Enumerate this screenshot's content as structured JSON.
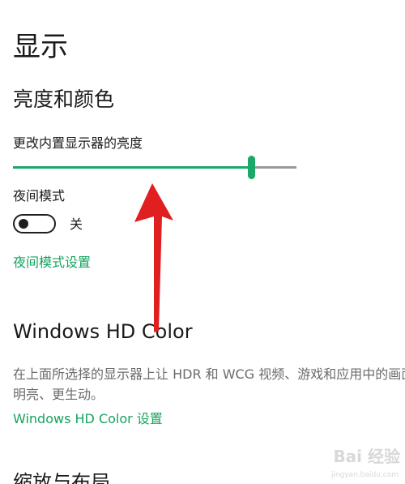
{
  "page": {
    "title": "显示"
  },
  "brightness_color": {
    "heading": "亮度和颜色",
    "slider_label": "更改内置显示器的亮度",
    "brightness_value": 0.84
  },
  "night_mode": {
    "label": "夜间模式",
    "toggle_state": "关",
    "is_on": false,
    "settings_link": "夜间模式设置"
  },
  "hd_color": {
    "heading": "Windows HD Color",
    "description_line1": "在上面所选择的显示器上让 HDR 和 WCG 视频、游戏和应用中的画面更",
    "description_line2": "明亮、更生动。",
    "settings_link": "Windows HD Color 设置"
  },
  "scale_layout": {
    "heading": "缩放与布局"
  },
  "watermark": {
    "brand": "Bai 经验",
    "url": "jingyan.baidu.com"
  },
  "colors": {
    "accent": "#1aa968",
    "link": "#17a35f",
    "arrow": "#e02020"
  },
  "icons": {
    "annotation": "red-up-arrow-icon"
  }
}
